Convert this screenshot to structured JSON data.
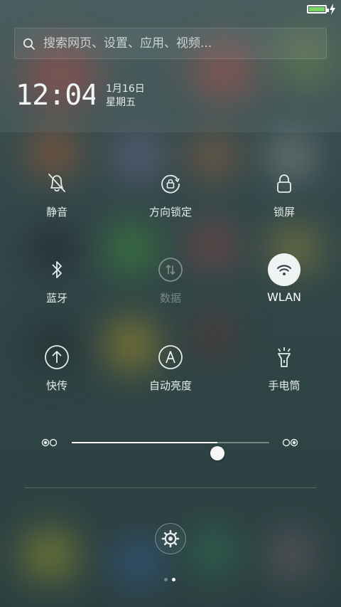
{
  "status_bar": {
    "battery_level": 1.0,
    "battery_color": "#7bd66a",
    "charging": true
  },
  "search": {
    "placeholder": "搜索网页、设置、应用、视频..."
  },
  "clock": {
    "time": "12:04",
    "date": "1月16日",
    "weekday": "星期五"
  },
  "toggles": [
    {
      "label": "静音",
      "icon": "bell-off-icon",
      "state": "off"
    },
    {
      "label": "方向锁定",
      "icon": "rotation-lock-icon",
      "state": "off"
    },
    {
      "label": "锁屏",
      "icon": "lock-icon",
      "state": "off"
    },
    {
      "label": "蓝牙",
      "icon": "bluetooth-icon",
      "state": "off"
    },
    {
      "label": "数据",
      "icon": "mobile-data-icon",
      "state": "disabled"
    },
    {
      "label": "WLAN",
      "icon": "wifi-icon",
      "state": "on"
    },
    {
      "label": "快传",
      "icon": "quick-transfer-icon",
      "state": "off"
    },
    {
      "label": "自动亮度",
      "icon": "auto-brightness-icon",
      "state": "off"
    },
    {
      "label": "手电筒",
      "icon": "flashlight-icon",
      "state": "off"
    }
  ],
  "brightness": {
    "level": 0.738
  },
  "pager": {
    "pages": 2,
    "current": 2
  },
  "colors": {
    "accent_on": "#eef3f3",
    "text": "#e6ecec",
    "battery": "#7bd66a"
  }
}
